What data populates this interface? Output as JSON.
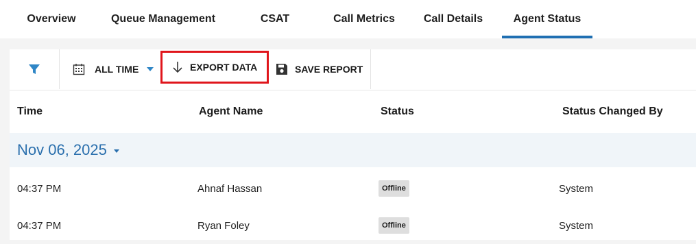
{
  "tabs": [
    {
      "label": "Overview"
    },
    {
      "label": "Queue Management"
    },
    {
      "label": "CSAT"
    },
    {
      "label": "Call Metrics"
    },
    {
      "label": "Call Details"
    },
    {
      "label": "Agent Status",
      "active": true
    }
  ],
  "toolbar": {
    "date_filter_label": "ALL TIME",
    "export_label": "EXPORT DATA",
    "save_label": "SAVE REPORT",
    "icons": [
      "filter-icon",
      "calendar-icon",
      "caret-down-icon",
      "arrow-down-icon",
      "save-icon"
    ]
  },
  "table": {
    "columns": [
      "Time",
      "Agent Name",
      "Status",
      "Status Changed By"
    ],
    "groups": [
      {
        "date": "Nov 06, 2025",
        "rows": [
          {
            "time": "04:37 PM",
            "agent": "Ahnaf Hassan",
            "status": "Offline",
            "changed_by": "System"
          },
          {
            "time": "04:37 PM",
            "agent": "Ryan Foley",
            "status": "Offline",
            "changed_by": "System"
          }
        ]
      }
    ]
  },
  "colors": {
    "accent": "#1f6fb2",
    "date_text": "#2a6fad",
    "highlight_border": "#e0151b",
    "badge_bg": "#dedede",
    "group_bg": "#f0f5f9"
  }
}
